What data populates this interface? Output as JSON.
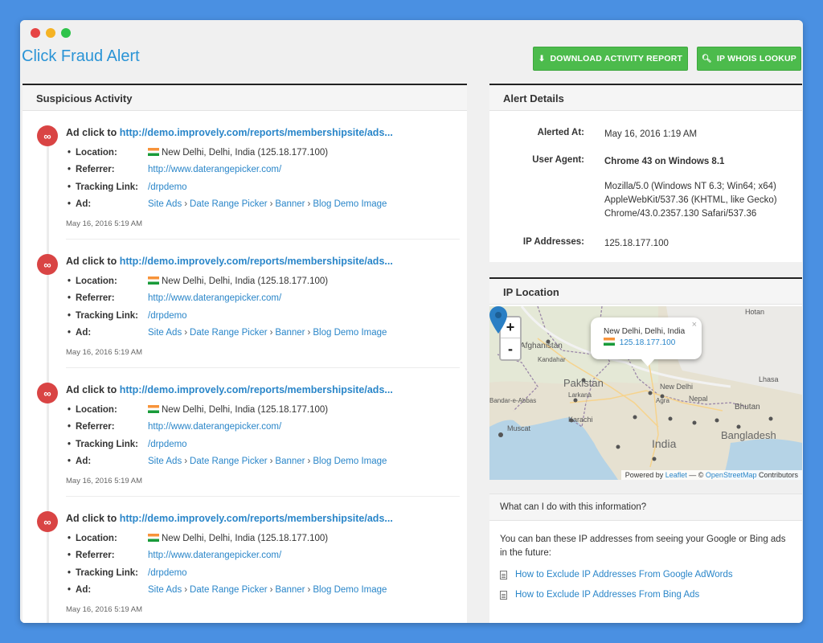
{
  "app": {
    "title": "Click Fraud Alert",
    "accent_color": "#2a94d6",
    "button_color": "#4cbb4c"
  },
  "toolbar": {
    "download_label": "DOWNLOAD ACTIVITY REPORT",
    "download_icon": "download-icon",
    "whois_label": "IP WHOIS LOOKUP",
    "whois_icon": "search-icon"
  },
  "activity": {
    "title": "Suspicious Activity",
    "labels": {
      "location": "Location:",
      "referrer": "Referrer:",
      "tracking": "Tracking Link:",
      "ad": "Ad:"
    },
    "entries": [
      {
        "prefix": "Ad click to ",
        "url": "http://demo.improvely.com/reports/membershipsite/ads...",
        "location": "New Delhi, Delhi, India (125.18.177.100)",
        "referrer": "http://www.daterangepicker.com/",
        "tracking": "/drpdemo",
        "ad_path": [
          "Site Ads",
          "Date Range Picker",
          "Banner",
          "Blog Demo Image"
        ],
        "date": "May 16, 2016 5:19 AM"
      },
      {
        "prefix": "Ad click to ",
        "url": "http://demo.improvely.com/reports/membershipsite/ads...",
        "location": "New Delhi, Delhi, India (125.18.177.100)",
        "referrer": "http://www.daterangepicker.com/",
        "tracking": "/drpdemo",
        "ad_path": [
          "Site Ads",
          "Date Range Picker",
          "Banner",
          "Blog Demo Image"
        ],
        "date": "May 16, 2016 5:19 AM"
      },
      {
        "prefix": "Ad click to ",
        "url": "http://demo.improvely.com/reports/membershipsite/ads...",
        "location": "New Delhi, Delhi, India (125.18.177.100)",
        "referrer": "http://www.daterangepicker.com/",
        "tracking": "/drpdemo",
        "ad_path": [
          "Site Ads",
          "Date Range Picker",
          "Banner",
          "Blog Demo Image"
        ],
        "date": "May 16, 2016 5:19 AM"
      },
      {
        "prefix": "Ad click to ",
        "url": "http://demo.improvely.com/reports/membershipsite/ads...",
        "location": "New Delhi, Delhi, India (125.18.177.100)",
        "referrer": "http://www.daterangepicker.com/",
        "tracking": "/drpdemo",
        "ad_path": [
          "Site Ads",
          "Date Range Picker",
          "Banner",
          "Blog Demo Image"
        ],
        "date": "May 16, 2016 5:19 AM"
      }
    ]
  },
  "alert": {
    "title": "Alert Details",
    "alerted_label": "Alerted At:",
    "alerted_value": "May 16, 2016 1:19 AM",
    "ua_label": "User Agent:",
    "ua_short": "Chrome 43 on Windows 8.1",
    "ua_full": "Mozilla/5.0 (Windows NT 6.3; Win64; x64) AppleWebKit/537.36 (KHTML, like Gecko) Chrome/43.0.2357.130 Safari/537.36",
    "ip_label": "IP Addresses:",
    "ip_value": "125.18.177.100"
  },
  "map": {
    "title": "IP Location",
    "zoom_in": "+",
    "zoom_out": "-",
    "popup_city": "New Delhi, Delhi, India",
    "popup_ip": "125.18.177.100",
    "popup_close": "×",
    "labels": {
      "afghanistan": "Afghanistan",
      "kandahar": "Kandahar",
      "pakistan": "Pakistan",
      "larkana": "Larkana",
      "karachi": "Karachi",
      "muscat": "Muscat",
      "bandar": "Bandar-e-Abbas",
      "agra": "Agra",
      "new_delhi": "New Delhi",
      "nepal": "Nepal",
      "lhasa": "Lhasa",
      "bhutan": "Bhutan",
      "india": "India",
      "bangladesh": "Bangladesh",
      "hotan": "Hotan"
    },
    "attrib_prefix": "Powered by ",
    "attrib_leaflet": "Leaflet",
    "attrib_mid": " — © ",
    "attrib_osm": "OpenStreetMap",
    "attrib_suffix": " Contributors"
  },
  "info": {
    "title": "What can I do with this information?",
    "text": "You can ban these IP addresses from seeing your Google or Bing ads in the future:",
    "link1": "How to Exclude IP Addresses From Google AdWords",
    "link2": "How to Exclude IP Addresses From Bing Ads"
  }
}
